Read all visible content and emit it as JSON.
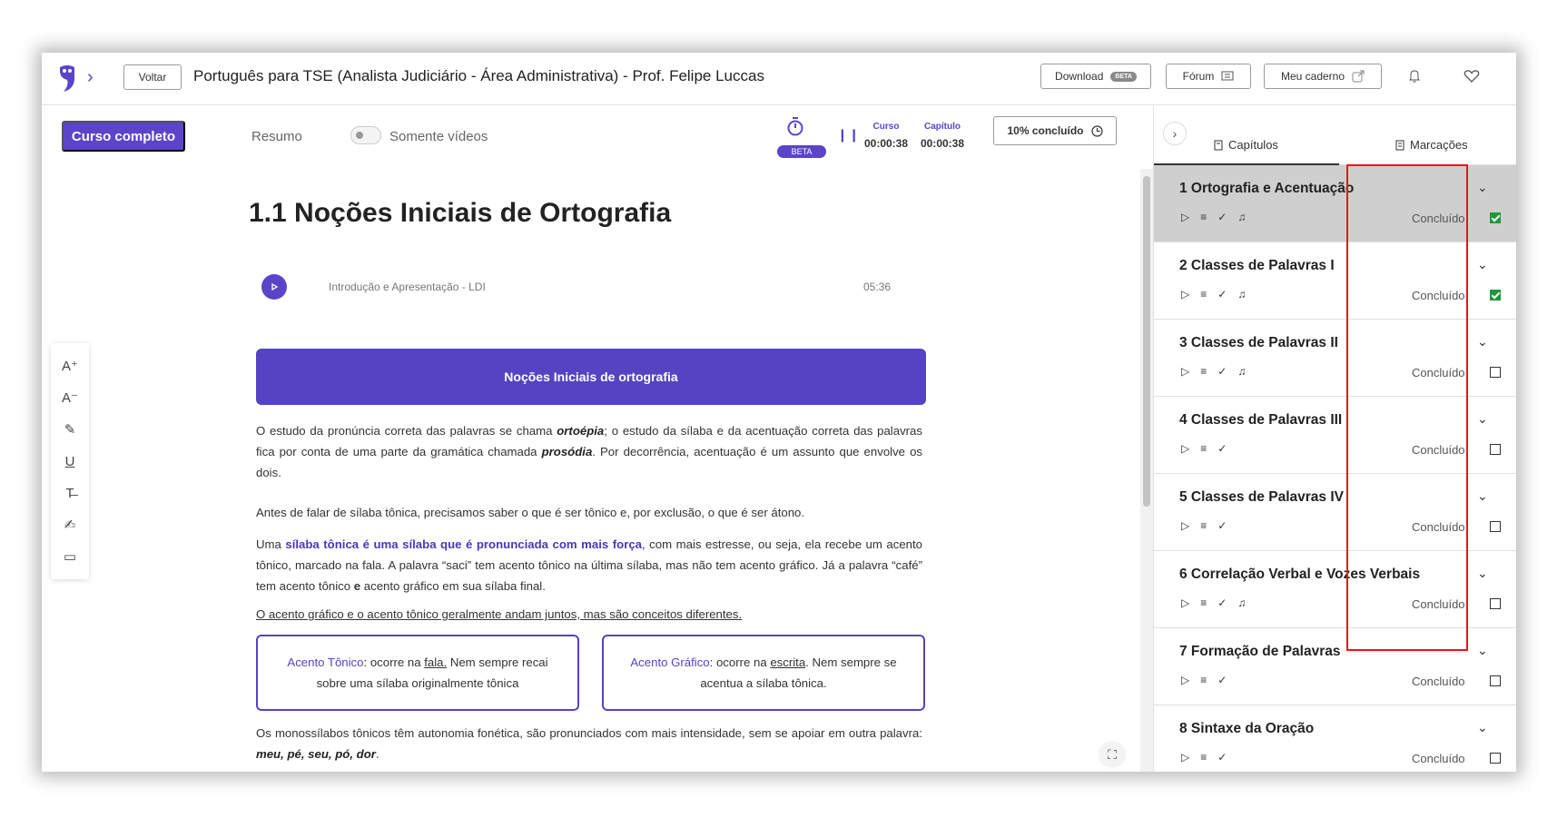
{
  "header": {
    "back_label": "Voltar",
    "course_title": "Português para TSE (Analista Judiciário - Área Administrativa) - Prof. Felipe Luccas",
    "download_label": "Download",
    "download_badge": "BETA",
    "forum_label": "Fórum",
    "notebook_label": "Meu caderno"
  },
  "subbar": {
    "full_course_label": "Curso completo",
    "summary_label": "Resumo",
    "videos_only_label": "Somente vídeos",
    "beta_label": "BETA",
    "course_time_label": "Curso",
    "course_time_value": "00:00:38",
    "chapter_time_label": "Capítulo",
    "chapter_time_value": "00:00:38",
    "progress_label": "10% concluído"
  },
  "tools": [
    "A⁺",
    "A⁻",
    "✎",
    "U",
    "T̶",
    "✍",
    "▭"
  ],
  "lesson": {
    "title": "1.1 Noções Iniciais de Ortografia",
    "video_label": "Introdução e Apresentação - LDI",
    "video_duration": "05:36",
    "banner": "Noções Iniciais de ortografia",
    "p1_a": "O estudo da pronúncia correta das palavras se chama ",
    "p1_b": "ortoépia",
    "p1_c": "; o estudo da sílaba e da acentuação correta das palavras fica por conta de uma parte da gramática chamada ",
    "p1_d": "prosódia",
    "p1_e": ". Por decorrência, acentuação é um assunto que envolve os dois.",
    "p2": "Antes de falar de sílaba tônica, precisamos saber o que é ser tônico e, por exclusão, o que é ser átono.",
    "p3_a": "Uma ",
    "p3_b": "sílaba tônica é uma sílaba que é pronunciada com mais força",
    "p3_c": ", com mais estresse, ou seja, ela recebe um acento tônico, marcado na fala. A palavra “saci” tem acento tônico na última sílaba, mas não tem acento gráfico. Já a palavra “café” tem acento tônico ",
    "p3_d": "e",
    "p3_e": " acento gráfico em sua sílaba final.",
    "p4": "O acento gráfico e o acento tônico geralmente andam juntos, mas são conceitos diferentes.",
    "box1_term": "Acento Tônico",
    "box1_a": ": ocorre na ",
    "box1_link": "fala.",
    "box1_b": " Nem sempre recai sobre uma sílaba originalmente tônica",
    "box2_term": "Acento Gráfico",
    "box2_a": ": ocorre na ",
    "box2_link": "escrita",
    "box2_b": ". Nem sempre se acentua a sílaba tônica.",
    "p5_a": "Os monossílabos tônicos têm autonomia fonética, são pronunciados com mais intensidade, sem se apoiar em outra palavra: ",
    "p5_b": "meu, pé, seu, pó, dor",
    "p5_c": "."
  },
  "sidebar": {
    "tab_chapters": "Capítulos",
    "tab_bookmarks": "Marcações",
    "status_label": "Concluído",
    "chapters": [
      {
        "title": "1 Ortografia e Acentuação",
        "done": true,
        "audio": true,
        "active": true
      },
      {
        "title": "2 Classes de Palavras I",
        "done": true,
        "audio": true,
        "active": false
      },
      {
        "title": "3 Classes de Palavras II",
        "done": false,
        "audio": true,
        "active": false
      },
      {
        "title": "4 Classes de Palavras III",
        "done": false,
        "audio": false,
        "active": false
      },
      {
        "title": "5 Classes de Palavras IV",
        "done": false,
        "audio": false,
        "active": false
      },
      {
        "title": "6 Correlação Verbal e Vozes Verbais",
        "done": false,
        "audio": true,
        "active": false
      },
      {
        "title": "7 Formação de Palavras",
        "done": false,
        "audio": false,
        "active": false
      },
      {
        "title": "8 Sintaxe da Oração",
        "done": false,
        "audio": false,
        "active": false
      }
    ]
  },
  "colors": {
    "accent": "#5c44c9",
    "done_green": "#1c9a3a",
    "annotation_red": "#e8141b"
  }
}
